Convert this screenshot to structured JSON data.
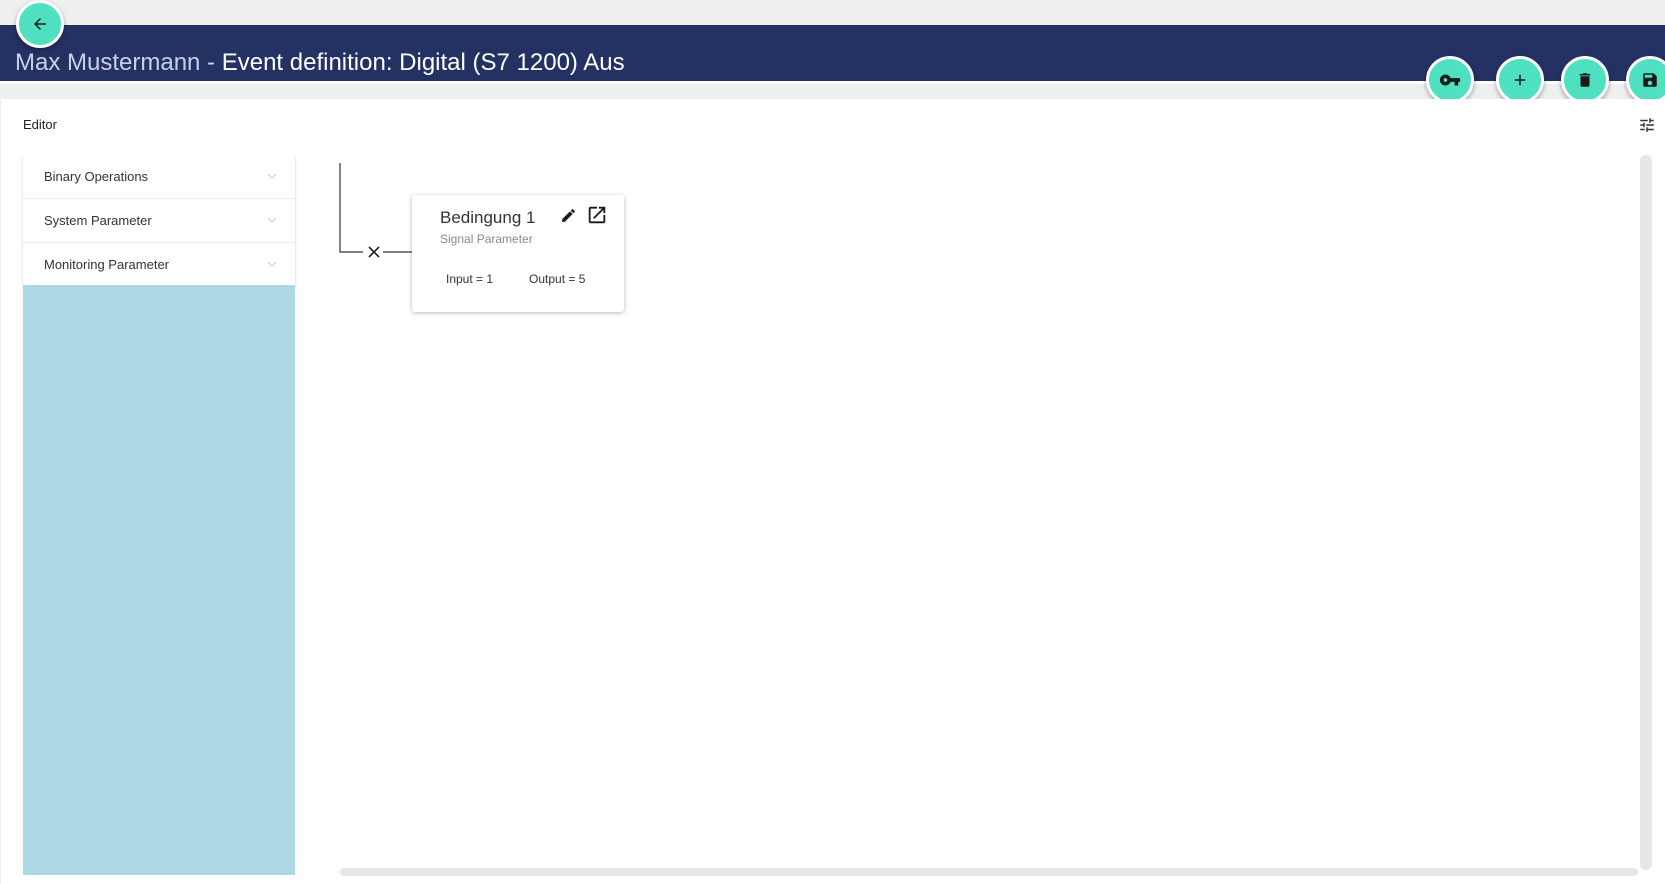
{
  "header": {
    "user_name": "Max Mustermann",
    "separator": " - ",
    "definition_title": "Event definition: Digital (S7 1200) Aus"
  },
  "toolbar": {
    "back_icon": "arrow-left-icon",
    "actions": [
      {
        "name": "key-button",
        "icon": "key-icon"
      },
      {
        "name": "add-button",
        "icon": "plus-icon"
      },
      {
        "name": "delete-button",
        "icon": "trash-icon"
      },
      {
        "name": "save-button",
        "icon": "floppy-disk-icon"
      }
    ]
  },
  "editor": {
    "label": "Editor",
    "settings_icon": "tune-icon"
  },
  "sidebar": {
    "items": [
      {
        "label": "Binary Operations"
      },
      {
        "label": "System Parameter"
      },
      {
        "label": "Monitoring Parameter"
      }
    ]
  },
  "node": {
    "title": "Bedingung 1",
    "subtitle": "Signal Parameter",
    "input_text": "Input = 1",
    "output_text": "Output = 5"
  },
  "colors": {
    "header_bg": "#233163",
    "accent": "#4ee0c1",
    "drop_area": "#add8e6"
  }
}
